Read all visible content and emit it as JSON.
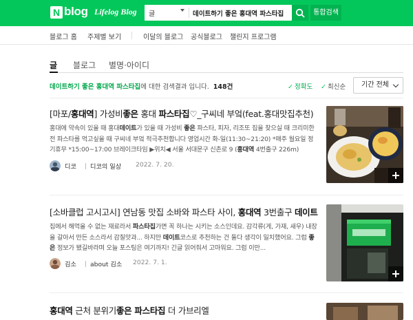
{
  "header": {
    "logo_n": "N",
    "logo_blog": "blog",
    "logo_sub": "Lifelog Blog",
    "search_category": "글",
    "search_query": "데이트하기 좋은 홍대역 파스타집",
    "all_search_label": "통합검색",
    "brand_color": "#03c75a"
  },
  "gnb": {
    "items": [
      "블로그 홈",
      "주제별 보기",
      "이달의 블로그",
      "공식블로그",
      "챌린지 프로그램"
    ]
  },
  "tabs": [
    "글",
    "블로그",
    "별명·아이디"
  ],
  "summary": {
    "keyword": "데이트하기 좋은 홍대역 파스타집",
    "suffix": "에 대한 검색결과 입니다.",
    "count": "148건"
  },
  "sort": {
    "accuracy": "정확도",
    "latest": "최신순",
    "period": "기간 전체"
  },
  "posts": [
    {
      "title_parts": [
        {
          "t": "[마포/",
          "b": false
        },
        {
          "t": "홍대역",
          "b": true
        },
        {
          "t": "] 가성비",
          "b": false
        },
        {
          "t": "좋은",
          "b": true
        },
        {
          "t": " 홍대 ",
          "b": false
        },
        {
          "t": "파스타집",
          "b": true
        },
        {
          "t": "♡_구씨네 부엌(feat.홍대맛집추천)",
          "b": false
        }
      ],
      "body_parts": [
        {
          "t": "홍대에 약속이 있을 때 홍대",
          "b": false
        },
        {
          "t": "데이트",
          "b": true
        },
        {
          "t": "가 있을 때 가성비 ",
          "b": false
        },
        {
          "t": "좋은",
          "b": true
        },
        {
          "t": " 파스타, 피자, 리조또 집을 찾으실 때 크리미한 전 파스타를 먹고싶을 때 구씨네 부엌 적극추천합니다 영업시간 화-일(11:30~21:20) *매주 월요일 정기휴무 *15:00~17:00 브레이크타임 ▶위치◀ 서울 서대문구 신촌로 9 (",
          "b": false
        },
        {
          "t": "홍대역",
          "b": true
        },
        {
          "t": " 4번출구 226m)",
          "b": false
        }
      ],
      "author": "디코",
      "blog": "디코의 일상",
      "date": "2022. 7. 20."
    },
    {
      "title_parts": [
        {
          "t": "[소바클럽 고시고시] 연남동 맛집 소바와 파스타 사이, ",
          "b": false
        },
        {
          "t": "홍대역",
          "b": true
        },
        {
          "t": " 3번출구 ",
          "b": false
        },
        {
          "t": "데이트",
          "b": true
        }
      ],
      "body_parts": [
        {
          "t": "집에서 해먹을 수 없는 재료라서 ",
          "b": false
        },
        {
          "t": "파스타집",
          "b": true
        },
        {
          "t": "가면 꼭 하나는 시키는 소스인데요. 감각류(게, 가재, 새우) 내장을 갈아서 만든 소스라서 감칠맛과... 하지만 ",
          "b": false
        },
        {
          "t": "데이트",
          "b": true
        },
        {
          "t": "코스로 추천하는 건 둘다 생각이 일치했어요. 그럼 ",
          "b": false
        },
        {
          "t": "좋은",
          "b": true
        },
        {
          "t": " 정보가 됐길바라며 오늘 포스팅은 여기까지! 긴글 읽어줘서 고마워요. 그럼 이만...",
          "b": false
        }
      ],
      "author": "김소",
      "blog": "about 김소",
      "date": "2022. 7. 1."
    },
    {
      "title_parts": [
        {
          "t": "홍대역",
          "b": true
        },
        {
          "t": " 근처 분위기",
          "b": false
        },
        {
          "t": "좋은 파스타집",
          "b": true
        },
        {
          "t": " 더 가브리엘",
          "b": false
        }
      ]
    }
  ]
}
